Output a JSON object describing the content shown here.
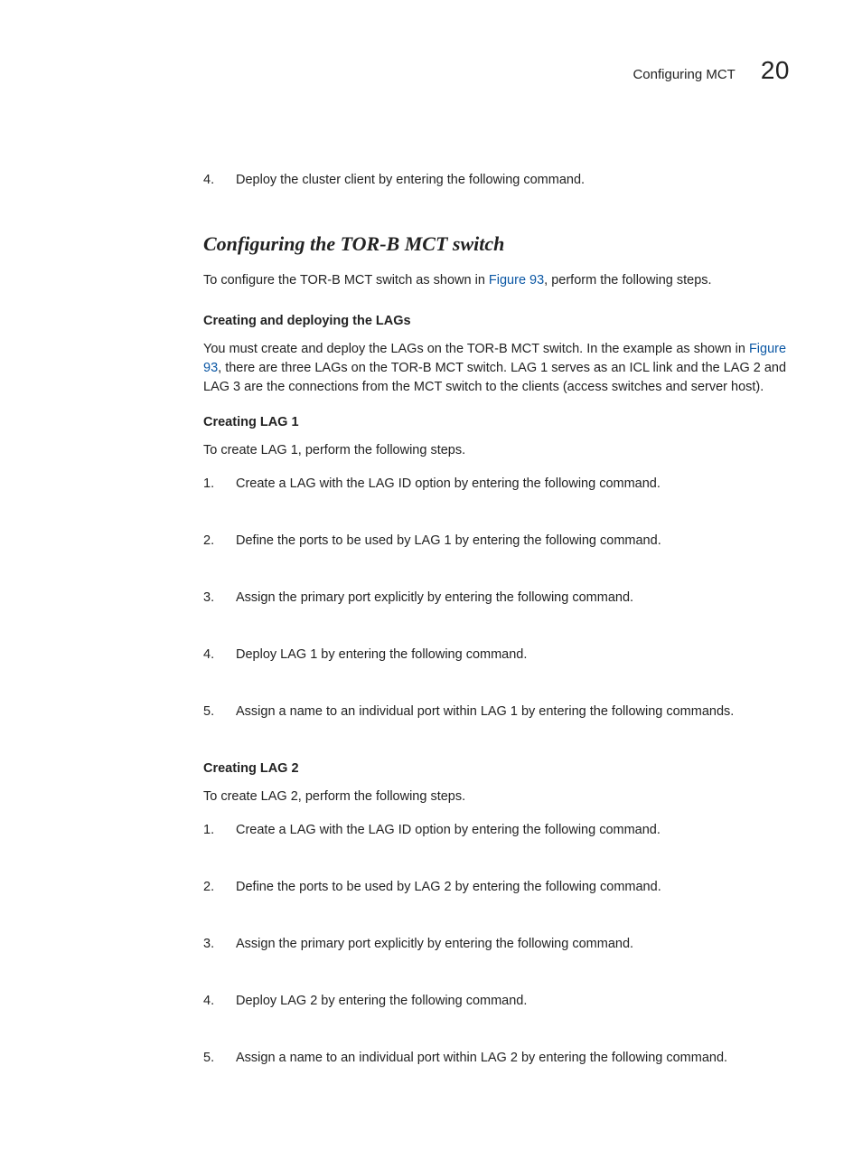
{
  "header": {
    "running_title": "Configuring MCT",
    "chapter_number": "20"
  },
  "orphan_step": {
    "number": "4.",
    "text": "Deploy the cluster client by entering the following command."
  },
  "section": {
    "title": "Configuring the TOR-B MCT switch",
    "intro_pre": "To configure the TOR-B MCT switch as shown in ",
    "intro_link": "Figure 93",
    "intro_post": ", perform the following steps."
  },
  "lags_intro": {
    "heading": "Creating and deploying the LAGs",
    "text_pre": "You must create and deploy the LAGs on the TOR-B MCT switch. In the example as shown in ",
    "text_link": "Figure 93",
    "text_post": ", there are three LAGs on the TOR-B MCT switch. LAG 1 serves as an ICL link and the LAG 2 and LAG 3 are the connections from the MCT switch to the clients (access switches and server host)."
  },
  "lag1": {
    "heading": "Creating LAG 1",
    "intro": "To create LAG 1, perform the following steps.",
    "steps": [
      {
        "n": "1.",
        "t": "Create a LAG with the LAG ID option by entering the following command."
      },
      {
        "n": "2.",
        "t": "Define the ports to be used by LAG 1 by entering the following command."
      },
      {
        "n": "3.",
        "t": "Assign the primary port explicitly by entering the following command."
      },
      {
        "n": "4.",
        "t": "Deploy LAG 1 by entering the following command."
      },
      {
        "n": "5.",
        "t": "Assign a name to an individual port within LAG 1 by entering the following commands."
      }
    ]
  },
  "lag2": {
    "heading": "Creating LAG 2",
    "intro": "To create LAG 2, perform the following steps.",
    "steps": [
      {
        "n": "1.",
        "t": "Create a LAG with the LAG ID option by entering the following command."
      },
      {
        "n": "2.",
        "t": "Define the ports to be used by LAG 2 by entering the following command."
      },
      {
        "n": "3.",
        "t": "Assign the primary port explicitly by entering the following command."
      },
      {
        "n": "4.",
        "t": "Deploy LAG 2 by entering the following command."
      },
      {
        "n": "5.",
        "t": "Assign a name to an individual port within LAG 2 by entering the following command."
      }
    ]
  }
}
